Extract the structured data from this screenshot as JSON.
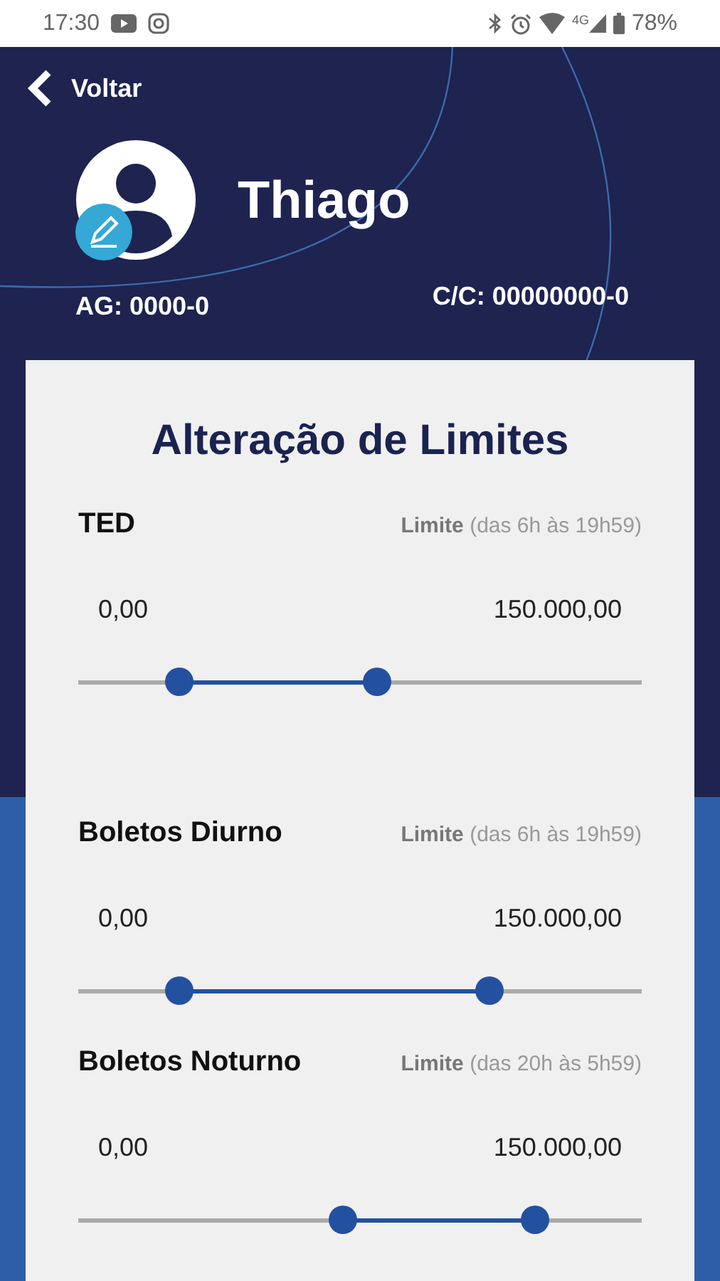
{
  "status_bar": {
    "time": "17:30",
    "network": "4G",
    "battery": "78%"
  },
  "header": {
    "back": "Voltar",
    "name": "Thiago",
    "agency": "AG: 0000-0",
    "account": "C/C: 00000000-0"
  },
  "card": {
    "title": "Alteração de Limites",
    "limits": [
      {
        "name": "TED",
        "period_label": "Limite",
        "period": "(das 6h às 19h59)",
        "min": "0,00",
        "max": "150.000,00",
        "thumbs": [
          {
            "level": 0.18
          },
          {
            "level": 0.53
          }
        ]
      },
      {
        "name": "Boletos Diurno",
        "period_label": "Limite",
        "period": "(das 6h às 19h59)",
        "min": "0,00",
        "max": "150.000,00",
        "thumbs": [
          {
            "level": 0.18
          },
          {
            "level": 0.73
          }
        ]
      },
      {
        "name": "Boletos Noturno",
        "period_label": "Limite",
        "period": "(das 20h às 5h59)",
        "min": "0,00",
        "max": "150.000,00",
        "thumbs": [
          {
            "level": 0.47
          },
          {
            "level": 0.81
          }
        ]
      }
    ]
  }
}
